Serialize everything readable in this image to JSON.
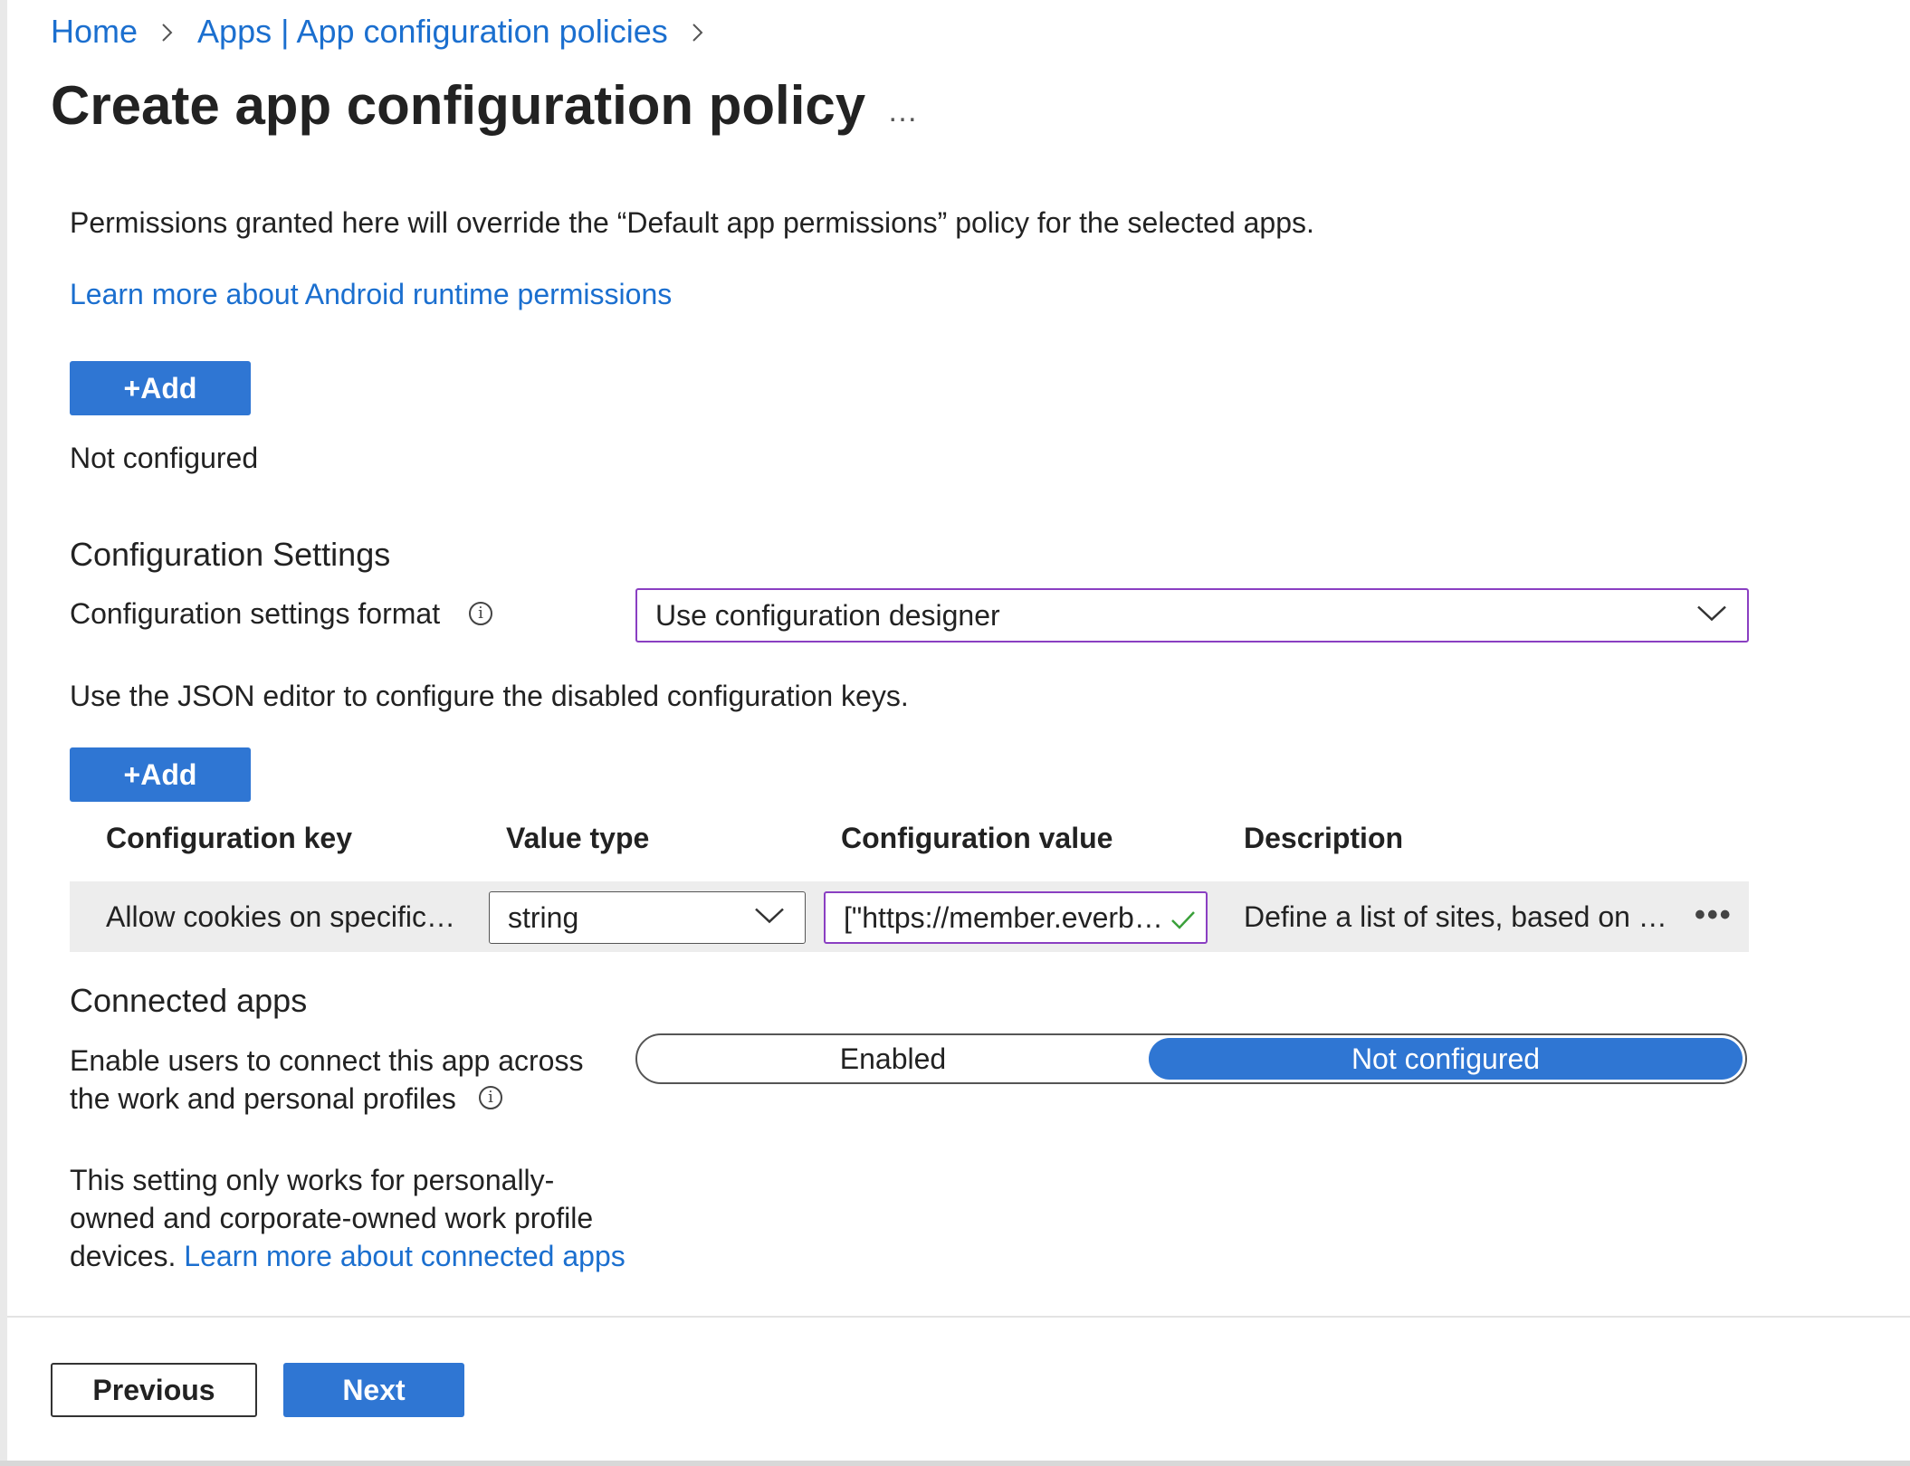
{
  "breadcrumb": {
    "items": [
      "Home",
      "Apps | App configuration policies"
    ]
  },
  "header": {
    "title": "Create app configuration policy",
    "more": "…"
  },
  "permissions": {
    "description": "Permissions granted here will override the “Default app permissions” policy for the selected apps.",
    "learn_more": "Learn more about Android runtime permissions",
    "add_label": "+Add",
    "status": "Not configured"
  },
  "configuration": {
    "heading": "Configuration Settings",
    "format_label": "Configuration settings format",
    "format_value": "Use configuration designer",
    "json_note": "Use the JSON editor to configure the disabled configuration keys.",
    "add_label": "+Add",
    "table": {
      "headers": [
        "Configuration key",
        "Value type",
        "Configuration value",
        "Description"
      ],
      "rows": [
        {
          "key": "Allow cookies on specific…",
          "value_type": "string",
          "value": "[\"https://member.everb…",
          "description": "Define a list of sites, based on …"
        }
      ]
    }
  },
  "connected_apps": {
    "heading": "Connected apps",
    "label_line1": "Enable users to connect this app across",
    "label_line2": "the work and personal profiles",
    "options": [
      "Enabled",
      "Not configured"
    ],
    "selected": "Not configured",
    "note_line1": "This setting only works for personally-",
    "note_line2": "owned and corporate-owned work profile",
    "note_line3_prefix": "devices.",
    "learn_more": "Learn more about connected apps"
  },
  "footer": {
    "previous_label": "Previous",
    "next_label": "Next"
  },
  "colors": {
    "accent": "#2f76d3",
    "link": "#1b6fcf",
    "focus_border": "#8a3fc2",
    "valid_check": "#3aa03a"
  },
  "icons": {
    "breadcrumb_separator": "chevron-right-icon",
    "info": "info-icon",
    "dropdown": "chevron-down-icon",
    "valid": "checkmark-icon",
    "more": "more-icon"
  }
}
